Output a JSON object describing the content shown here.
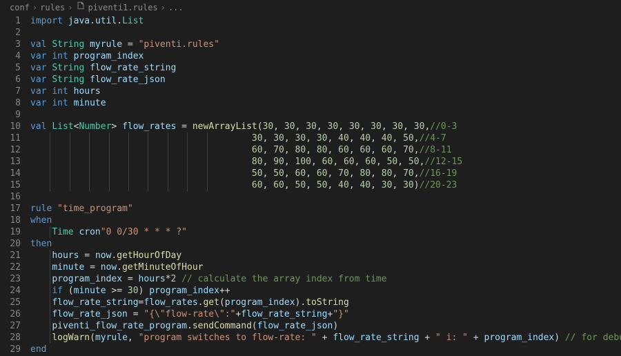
{
  "breadcrumb": {
    "parts": [
      "conf",
      "rules",
      "piventi1.rules",
      "..."
    ],
    "separator": "›"
  },
  "lines": [
    {
      "n": 1,
      "indent": 0,
      "tokens": [
        [
          "kw",
          "import"
        ],
        [
          "punc",
          " "
        ],
        [
          "ident",
          "java"
        ],
        [
          "punc",
          "."
        ],
        [
          "ident",
          "util"
        ],
        [
          "punc",
          "."
        ],
        [
          "type",
          "List"
        ]
      ]
    },
    {
      "n": 2,
      "indent": 0,
      "tokens": []
    },
    {
      "n": 3,
      "indent": 0,
      "tokens": [
        [
          "kw",
          "val"
        ],
        [
          "punc",
          " "
        ],
        [
          "type",
          "String"
        ],
        [
          "punc",
          " "
        ],
        [
          "ident",
          "myrule"
        ],
        [
          "punc",
          " = "
        ],
        [
          "str",
          "\"piventi.rules\""
        ]
      ]
    },
    {
      "n": 4,
      "indent": 0,
      "tokens": [
        [
          "kw",
          "var"
        ],
        [
          "punc",
          " "
        ],
        [
          "kw",
          "int"
        ],
        [
          "punc",
          " "
        ],
        [
          "ident",
          "program_index"
        ]
      ]
    },
    {
      "n": 5,
      "indent": 0,
      "tokens": [
        [
          "kw",
          "var"
        ],
        [
          "punc",
          " "
        ],
        [
          "type",
          "String"
        ],
        [
          "punc",
          " "
        ],
        [
          "ident",
          "flow_rate_string"
        ]
      ]
    },
    {
      "n": 6,
      "indent": 0,
      "tokens": [
        [
          "kw",
          "var"
        ],
        [
          "punc",
          " "
        ],
        [
          "type",
          "String"
        ],
        [
          "punc",
          " "
        ],
        [
          "ident",
          "flow_rate_json"
        ]
      ]
    },
    {
      "n": 7,
      "indent": 0,
      "tokens": [
        [
          "kw",
          "var"
        ],
        [
          "punc",
          " "
        ],
        [
          "kw",
          "int"
        ],
        [
          "punc",
          " "
        ],
        [
          "ident",
          "hours"
        ]
      ]
    },
    {
      "n": 8,
      "indent": 0,
      "tokens": [
        [
          "kw",
          "var"
        ],
        [
          "punc",
          " "
        ],
        [
          "kw",
          "int"
        ],
        [
          "punc",
          " "
        ],
        [
          "ident",
          "minute"
        ]
      ]
    },
    {
      "n": 9,
      "indent": 0,
      "tokens": []
    },
    {
      "n": 10,
      "indent": 0,
      "tokens": [
        [
          "kw",
          "val"
        ],
        [
          "punc",
          " "
        ],
        [
          "type",
          "List"
        ],
        [
          "punc",
          "<"
        ],
        [
          "type",
          "Number"
        ],
        [
          "punc",
          "> "
        ],
        [
          "ident",
          "flow_rates"
        ],
        [
          "punc",
          " = "
        ],
        [
          "fn",
          "newArrayList"
        ],
        [
          "punc",
          "("
        ],
        [
          "num",
          "30"
        ],
        [
          "punc",
          ", "
        ],
        [
          "num",
          "30"
        ],
        [
          "punc",
          ", "
        ],
        [
          "num",
          "30"
        ],
        [
          "punc",
          ", "
        ],
        [
          "num",
          "30"
        ],
        [
          "punc",
          ", "
        ],
        [
          "num",
          "30"
        ],
        [
          "punc",
          ", "
        ],
        [
          "num",
          "30"
        ],
        [
          "punc",
          ", "
        ],
        [
          "num",
          "30"
        ],
        [
          "punc",
          ", "
        ],
        [
          "num",
          "30"
        ],
        [
          "punc",
          ","
        ],
        [
          "comm",
          "//0-3"
        ]
      ]
    },
    {
      "n": 11,
      "indent": 0,
      "tokens": [
        [
          "punc",
          "                                         "
        ],
        [
          "num",
          "30"
        ],
        [
          "punc",
          ", "
        ],
        [
          "num",
          "30"
        ],
        [
          "punc",
          ", "
        ],
        [
          "num",
          "30"
        ],
        [
          "punc",
          ", "
        ],
        [
          "num",
          "30"
        ],
        [
          "punc",
          ", "
        ],
        [
          "num",
          "40"
        ],
        [
          "punc",
          ", "
        ],
        [
          "num",
          "40"
        ],
        [
          "punc",
          ", "
        ],
        [
          "num",
          "40"
        ],
        [
          "punc",
          ", "
        ],
        [
          "num",
          "50"
        ],
        [
          "punc",
          ","
        ],
        [
          "comm",
          "//4-7"
        ]
      ]
    },
    {
      "n": 12,
      "indent": 0,
      "tokens": [
        [
          "punc",
          "                                         "
        ],
        [
          "num",
          "60"
        ],
        [
          "punc",
          ", "
        ],
        [
          "num",
          "70"
        ],
        [
          "punc",
          ", "
        ],
        [
          "num",
          "80"
        ],
        [
          "punc",
          ", "
        ],
        [
          "num",
          "80"
        ],
        [
          "punc",
          ", "
        ],
        [
          "num",
          "60"
        ],
        [
          "punc",
          ", "
        ],
        [
          "num",
          "60"
        ],
        [
          "punc",
          ", "
        ],
        [
          "num",
          "60"
        ],
        [
          "punc",
          ", "
        ],
        [
          "num",
          "70"
        ],
        [
          "punc",
          ","
        ],
        [
          "comm",
          "//8-11"
        ]
      ]
    },
    {
      "n": 13,
      "indent": 0,
      "tokens": [
        [
          "punc",
          "                                         "
        ],
        [
          "num",
          "80"
        ],
        [
          "punc",
          ", "
        ],
        [
          "num",
          "90"
        ],
        [
          "punc",
          ", "
        ],
        [
          "num",
          "100"
        ],
        [
          "punc",
          ", "
        ],
        [
          "num",
          "60"
        ],
        [
          "punc",
          ", "
        ],
        [
          "num",
          "60"
        ],
        [
          "punc",
          ", "
        ],
        [
          "num",
          "60"
        ],
        [
          "punc",
          ", "
        ],
        [
          "num",
          "50"
        ],
        [
          "punc",
          ", "
        ],
        [
          "num",
          "50"
        ],
        [
          "punc",
          ","
        ],
        [
          "comm",
          "//12-15"
        ]
      ]
    },
    {
      "n": 14,
      "indent": 0,
      "tokens": [
        [
          "punc",
          "                                         "
        ],
        [
          "num",
          "50"
        ],
        [
          "punc",
          ", "
        ],
        [
          "num",
          "50"
        ],
        [
          "punc",
          ", "
        ],
        [
          "num",
          "60"
        ],
        [
          "punc",
          ", "
        ],
        [
          "num",
          "60"
        ],
        [
          "punc",
          ", "
        ],
        [
          "num",
          "70"
        ],
        [
          "punc",
          ", "
        ],
        [
          "num",
          "80"
        ],
        [
          "punc",
          ", "
        ],
        [
          "num",
          "80"
        ],
        [
          "punc",
          ", "
        ],
        [
          "num",
          "70"
        ],
        [
          "punc",
          ","
        ],
        [
          "comm",
          "//16-19"
        ]
      ]
    },
    {
      "n": 15,
      "indent": 0,
      "tokens": [
        [
          "punc",
          "                                         "
        ],
        [
          "num",
          "60"
        ],
        [
          "punc",
          ", "
        ],
        [
          "num",
          "60"
        ],
        [
          "punc",
          ", "
        ],
        [
          "num",
          "50"
        ],
        [
          "punc",
          ", "
        ],
        [
          "num",
          "50"
        ],
        [
          "punc",
          ", "
        ],
        [
          "num",
          "40"
        ],
        [
          "punc",
          ", "
        ],
        [
          "num",
          "40"
        ],
        [
          "punc",
          ", "
        ],
        [
          "num",
          "30"
        ],
        [
          "punc",
          ", "
        ],
        [
          "num",
          "30"
        ],
        [
          "punc",
          ")"
        ],
        [
          "comm",
          "//20-23"
        ]
      ]
    },
    {
      "n": 16,
      "indent": 0,
      "tokens": []
    },
    {
      "n": 17,
      "indent": 0,
      "tokens": [
        [
          "kw",
          "rule"
        ],
        [
          "punc",
          " "
        ],
        [
          "str",
          "\"time_program\""
        ]
      ]
    },
    {
      "n": 18,
      "indent": 0,
      "tokens": [
        [
          "kw",
          "when"
        ]
      ]
    },
    {
      "n": 19,
      "indent": 1,
      "tokens": [
        [
          "punc",
          "    "
        ],
        [
          "type",
          "Time"
        ],
        [
          "punc",
          " "
        ],
        [
          "ident",
          "cron"
        ],
        [
          "str",
          "\"0 0/30 * * * ?\""
        ]
      ]
    },
    {
      "n": 20,
      "indent": 0,
      "tokens": [
        [
          "kw",
          "then"
        ]
      ]
    },
    {
      "n": 21,
      "indent": 1,
      "tokens": [
        [
          "punc",
          "    "
        ],
        [
          "ident",
          "hours"
        ],
        [
          "punc",
          " = "
        ],
        [
          "ident",
          "now"
        ],
        [
          "punc",
          "."
        ],
        [
          "fn",
          "getHourOfDay"
        ]
      ]
    },
    {
      "n": 22,
      "indent": 1,
      "tokens": [
        [
          "punc",
          "    "
        ],
        [
          "ident",
          "minute"
        ],
        [
          "punc",
          " = "
        ],
        [
          "ident",
          "now"
        ],
        [
          "punc",
          "."
        ],
        [
          "fn",
          "getMinuteOfHour"
        ]
      ]
    },
    {
      "n": 23,
      "indent": 1,
      "tokens": [
        [
          "punc",
          "    "
        ],
        [
          "ident",
          "program_index"
        ],
        [
          "punc",
          " = "
        ],
        [
          "ident",
          "hours"
        ],
        [
          "punc",
          "*"
        ],
        [
          "num",
          "2"
        ],
        [
          "punc",
          " "
        ],
        [
          "comm",
          "// calculate the array index from time"
        ]
      ]
    },
    {
      "n": 24,
      "indent": 1,
      "tokens": [
        [
          "punc",
          "    "
        ],
        [
          "kw",
          "if"
        ],
        [
          "punc",
          " ("
        ],
        [
          "ident",
          "minute"
        ],
        [
          "punc",
          " >= "
        ],
        [
          "num",
          "30"
        ],
        [
          "punc",
          ") "
        ],
        [
          "ident",
          "program_index"
        ],
        [
          "punc",
          "++"
        ]
      ]
    },
    {
      "n": 25,
      "indent": 1,
      "tokens": [
        [
          "punc",
          "    "
        ],
        [
          "ident",
          "flow_rate_string"
        ],
        [
          "punc",
          "="
        ],
        [
          "ident",
          "flow_rates"
        ],
        [
          "punc",
          "."
        ],
        [
          "fn",
          "get"
        ],
        [
          "punc",
          "("
        ],
        [
          "ident",
          "program_index"
        ],
        [
          "punc",
          ")."
        ],
        [
          "fn",
          "toString"
        ]
      ]
    },
    {
      "n": 26,
      "indent": 1,
      "tokens": [
        [
          "punc",
          "    "
        ],
        [
          "ident",
          "flow_rate_json"
        ],
        [
          "punc",
          " = "
        ],
        [
          "str",
          "\"{\\\"flow-rate\\\":\""
        ],
        [
          "punc",
          "+"
        ],
        [
          "ident",
          "flow_rate_string"
        ],
        [
          "punc",
          "+"
        ],
        [
          "str",
          "\"}\""
        ]
      ]
    },
    {
      "n": 27,
      "indent": 1,
      "tokens": [
        [
          "punc",
          "    "
        ],
        [
          "ident",
          "piventi_flow_rate_program"
        ],
        [
          "punc",
          "."
        ],
        [
          "fn",
          "sendCommand"
        ],
        [
          "punc",
          "("
        ],
        [
          "ident",
          "flow_rate_json"
        ],
        [
          "punc",
          ")"
        ]
      ]
    },
    {
      "n": 28,
      "indent": 1,
      "tokens": [
        [
          "punc",
          "    "
        ],
        [
          "fn",
          "logWarn"
        ],
        [
          "punc",
          "("
        ],
        [
          "ident",
          "myrule"
        ],
        [
          "punc",
          ", "
        ],
        [
          "str",
          "\"program switches to flow-rate: \""
        ],
        [
          "punc",
          " + "
        ],
        [
          "ident",
          "flow_rate_string"
        ],
        [
          "punc",
          " + "
        ],
        [
          "str",
          "\" i: \""
        ],
        [
          "punc",
          " + "
        ],
        [
          "ident",
          "program_index"
        ],
        [
          "punc",
          ") "
        ],
        [
          "comm",
          "// for debug"
        ]
      ]
    },
    {
      "n": 29,
      "indent": 0,
      "tokens": [
        [
          "kw",
          "end"
        ]
      ]
    }
  ],
  "indent_guides": {
    "lines_11_15": [
      4,
      8,
      12,
      16,
      20,
      24,
      28,
      32,
      36
    ],
    "line_19": [
      4
    ],
    "lines_21_28": [
      4
    ]
  }
}
